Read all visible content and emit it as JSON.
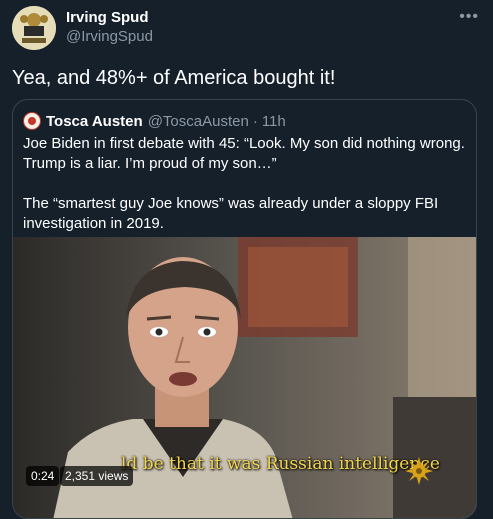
{
  "tweet": {
    "author_name": "Irving Spud",
    "author_handle": "@IrvingSpud",
    "text": "Yea, and 48%+ of America bought it!"
  },
  "quoted_tweet": {
    "author_name": "Tosca Austen",
    "author_handle": "@ToscaAusten",
    "separator": "·",
    "time": "11h",
    "paragraphs": [
      "Joe Biden in first debate with 45: “Look. My son did nothing wrong. Trump is a liar. I’m proud of my son…”",
      "The “smartest guy Joe knows” was already under a sloppy FBI investigation in 2019."
    ],
    "video": {
      "caption": "ld be that it was Russian intelligence",
      "elapsed": "0:24",
      "views": "2,351 views"
    }
  },
  "icons": {
    "more": "more-horizontal-icon",
    "broadcaster_logo": "sun-logo-icon"
  },
  "colors": {
    "background": "#15202b",
    "secondary_text": "#8b98a5",
    "border": "#38444d",
    "caption": "#f2d54a"
  }
}
